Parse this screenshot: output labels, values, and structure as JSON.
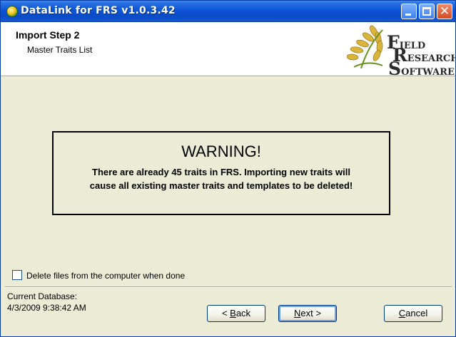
{
  "window": {
    "title": "DataLink for FRS v1.0.3.42",
    "controls": {
      "minimize": "minimize-icon",
      "maximize": "maximize-icon",
      "close": "close-icon"
    }
  },
  "header": {
    "step_title": "Import Step 2",
    "step_subtitle": "Master Traits List",
    "logo": {
      "line1_cap": "F",
      "line1_rest": "IELD",
      "line2_cap": "R",
      "line2_rest": "ESEARCH",
      "line3_cap": "S",
      "line3_rest": "OFTWARE"
    }
  },
  "warning": {
    "title": "WARNING!",
    "message_line1": "There are already 45 traits in FRS. Importing new traits will",
    "message_line2": "cause all existing master traits and templates to be deleted!"
  },
  "options": {
    "delete_files_label": "Delete files from the computer when done",
    "delete_files_checked": false
  },
  "footer": {
    "db_label": "Current Database:",
    "db_value": "4/3/2009 9:38:42 AM",
    "buttons": {
      "back_prefix": "< ",
      "back_key": "B",
      "back_rest": "ack",
      "next_key": "N",
      "next_rest": "ext >",
      "cancel_key": "C",
      "cancel_rest": "ancel"
    }
  },
  "colors": {
    "titlebar": "#0d55d6",
    "body_bg": "#ecebd6",
    "button_border": "#003c74"
  }
}
